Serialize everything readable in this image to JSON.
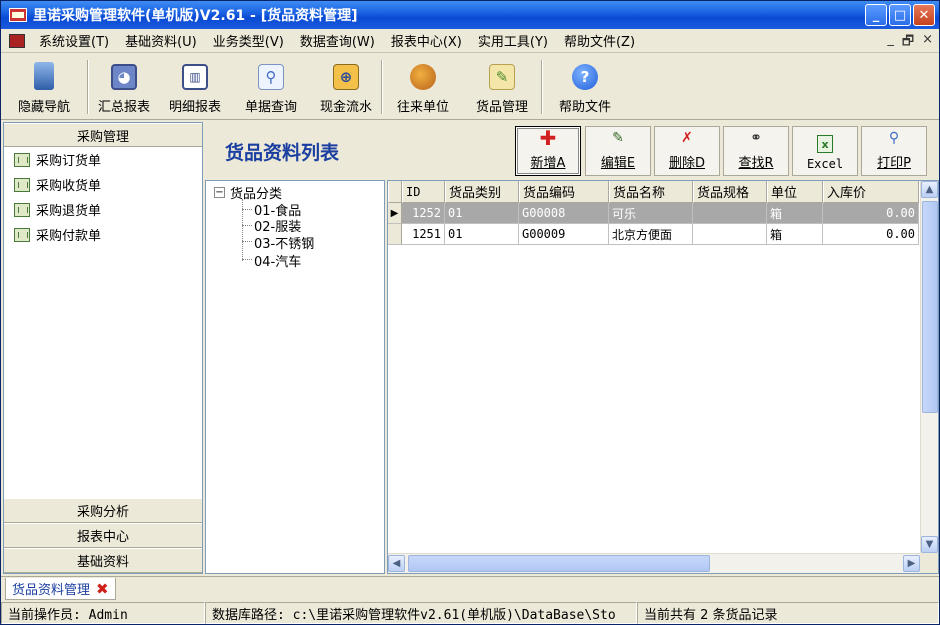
{
  "window": {
    "title": "里诺采购管理软件(单机版)V2.61 - [货品资料管理]"
  },
  "menu": {
    "items": [
      "系统设置(T)",
      "基础资料(U)",
      "业务类型(V)",
      "数据查询(W)",
      "报表中心(X)",
      "实用工具(Y)",
      "帮助文件(Z)"
    ],
    "mdi": [
      "_",
      "🗗",
      "×"
    ]
  },
  "toolbar": {
    "items": [
      "隐藏导航",
      "汇总报表",
      "明细报表",
      "单据查询",
      "现金流水",
      "往来单位",
      "货品管理",
      "帮助文件"
    ]
  },
  "nav": {
    "top_group": "采购管理",
    "items": [
      "采购订货单",
      "采购收货单",
      "采购退货单",
      "采购付款单"
    ],
    "bottom_groups": [
      "采购分析",
      "报表中心",
      "基础资料"
    ]
  },
  "main": {
    "title": "货品资料列表",
    "buttons": [
      "新增A",
      "编辑E",
      "删除D",
      "查找R",
      "Excel",
      "打印P"
    ]
  },
  "tree": {
    "root": "货品分类",
    "expander": "−",
    "children": [
      "01-食品",
      "02-服装",
      "03-不锈钢",
      "04-汽车"
    ]
  },
  "grid": {
    "columns": [
      "ID",
      "货品类别",
      "货品编码",
      "货品名称",
      "货品规格",
      "单位",
      "入库价"
    ],
    "rows": [
      {
        "id": "1252",
        "category": "01",
        "code": "G00008",
        "name": "可乐",
        "spec": "",
        "unit": "箱",
        "price": "0.00",
        "selected": true
      },
      {
        "id": "1251",
        "category": "01",
        "code": "G00009",
        "name": "北京方便面",
        "spec": "",
        "unit": "箱",
        "price": "0.00",
        "selected": false
      }
    ]
  },
  "tabs": {
    "active": "货品资料管理"
  },
  "status": {
    "operator": "当前操作员: Admin",
    "db_path": "数据库路径: c:\\里诺采购管理软件v2.61(单机版)\\DataBase\\Sto",
    "record_count": "当前共有 2 条货品记录"
  },
  "colors": {
    "title_blue": "#1a3fa0",
    "titlebar": "#0a4ad3",
    "selected_row": "#a8a8a8"
  }
}
